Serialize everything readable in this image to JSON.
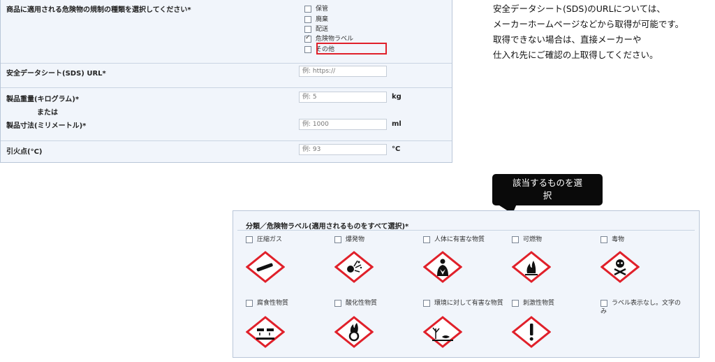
{
  "form": {
    "regulation_row": {
      "label": "商品に適用される危険物の規制の種類を選択してください*",
      "options": [
        {
          "label": "保管",
          "checked": false
        },
        {
          "label": "廃棄",
          "checked": false
        },
        {
          "label": "配送",
          "checked": false
        },
        {
          "label": "危険物ラベル",
          "checked": true
        },
        {
          "label": "その他",
          "checked": false
        }
      ]
    },
    "sds_row": {
      "label": "安全データシート(SDS) URL*",
      "placeholder": "例: https://"
    },
    "weight_row": {
      "label": "製品重量(キログラム)*",
      "placeholder": "例: 5",
      "unit": "kg"
    },
    "or_label": "または",
    "dimension_row": {
      "label": "製品寸法(ミリメートル)*",
      "placeholder": "例: 1000",
      "unit": "ml"
    },
    "flash_row": {
      "label": "引火点(°C)",
      "placeholder": "例: 93",
      "unit": "°C"
    }
  },
  "note": {
    "lines": [
      "安全データシート(SDS)のURLについては、",
      "メーカーホームページなどから取得が可能です。",
      "取得できない場合は、直接メーカーや",
      "仕入れ先にご確認の上取得してください。"
    ]
  },
  "callout": {
    "lines": [
      "該当するものを選",
      "択"
    ]
  },
  "classification": {
    "title": "分類／危険物ラベル(適用されるものをすべて選択)*",
    "items": [
      {
        "label": "圧縮ガス",
        "icon": "gas-cylinder-icon"
      },
      {
        "label": "爆発物",
        "icon": "exploding-bomb-icon"
      },
      {
        "label": "人体に有害な物質",
        "icon": "health-hazard-icon"
      },
      {
        "label": "可燃物",
        "icon": "flame-icon"
      },
      {
        "label": "毒物",
        "icon": "skull-crossbones-icon"
      },
      {
        "label": "腐食性物質",
        "icon": "corrosion-icon"
      },
      {
        "label": "酸化性物質",
        "icon": "flame-over-circle-icon"
      },
      {
        "label": "環境に対して有害な物質",
        "icon": "environment-icon"
      },
      {
        "label": "刺激性物質",
        "icon": "exclamation-mark-icon"
      },
      {
        "label": "ラベル表示なし。文字のみ",
        "icon": ""
      }
    ]
  },
  "colors": {
    "hazard_red": "#e0202a",
    "panel_bg": "#f1f5fb",
    "highlight": "#e0202a"
  }
}
